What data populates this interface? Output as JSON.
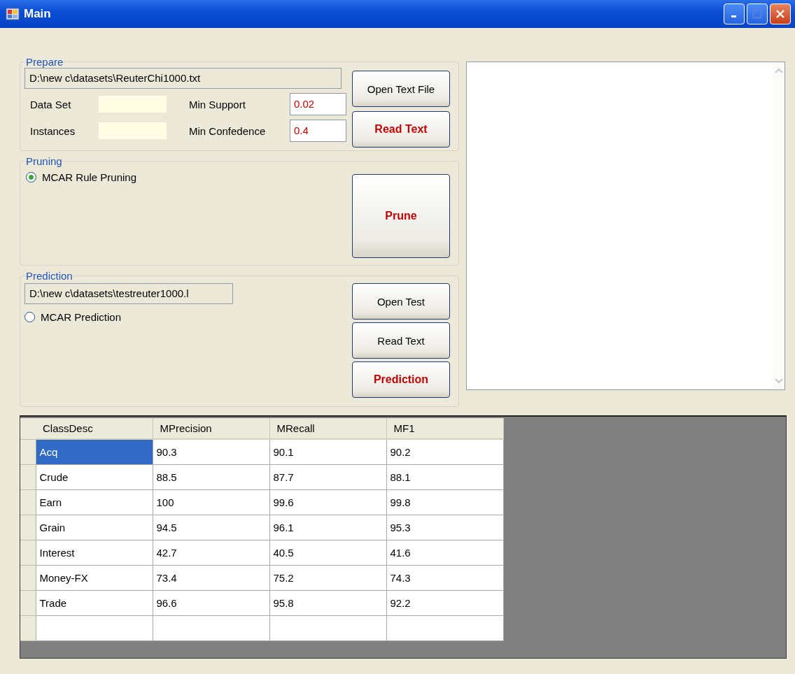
{
  "window": {
    "title": "Main"
  },
  "prepare": {
    "title": "Prepare",
    "file_path": "D:\\new c\\datasets\\ReuterChi1000.txt",
    "data_set_label": "Data Set",
    "instances_label": "Instances",
    "min_support": {
      "label": "Min Support",
      "value": "0.02"
    },
    "min_confidence": {
      "label": "Min Confedence",
      "value": "0.4"
    },
    "buttons": [
      {
        "label": "Open Text File",
        "emphasized": false
      },
      {
        "label": "Read Text",
        "emphasized": true
      }
    ]
  },
  "pruning": {
    "title": "Pruning",
    "options": [
      {
        "label": "MCAR Rule Pruning",
        "selected": true
      }
    ],
    "button": {
      "label": "Prune",
      "emphasized": true
    }
  },
  "prediction": {
    "title": "Prediction",
    "file_path": "D:\\new c\\datasets\\testreuter1000.l",
    "options": [
      {
        "label": "MCAR Prediction",
        "selected": false
      }
    ],
    "buttons": [
      {
        "label": "Open Test",
        "emphasized": false
      },
      {
        "label": "Read Text",
        "emphasized": false
      },
      {
        "label": "Prediction",
        "emphasized": true
      }
    ]
  },
  "table": {
    "columns": [
      "ClassDesc",
      "MPrecision",
      "MRecall",
      "MF1"
    ],
    "rows": [
      {
        "cells": [
          "Acq",
          "90.3",
          "90.1",
          "90.2"
        ],
        "selected": true
      },
      {
        "cells": [
          "Crude",
          "88.5",
          "87.7",
          "88.1"
        ],
        "selected": false
      },
      {
        "cells": [
          "Earn",
          "100",
          "99.6",
          "99.8"
        ],
        "selected": false
      },
      {
        "cells": [
          "Grain",
          "94.5",
          "96.1",
          "95.3"
        ],
        "selected": false
      },
      {
        "cells": [
          "Interest",
          "42.7",
          "40.5",
          "41.6"
        ],
        "selected": false
      },
      {
        "cells": [
          "Money-FX",
          "73.4",
          "75.2",
          "74.3"
        ],
        "selected": false
      },
      {
        "cells": [
          "Trade",
          "96.6",
          "95.8",
          "92.2"
        ],
        "selected": false
      }
    ]
  }
}
